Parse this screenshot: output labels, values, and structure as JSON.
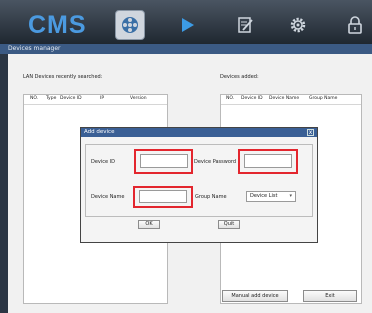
{
  "app": {
    "logo": "CMS"
  },
  "toolbar": {
    "items": [
      {
        "name": "video-reel-icon",
        "active": true
      },
      {
        "name": "play-icon",
        "active": false
      },
      {
        "name": "edit-icon",
        "active": false
      },
      {
        "name": "gear-icon",
        "active": false
      },
      {
        "name": "lock-icon",
        "active": false
      }
    ]
  },
  "window": {
    "title": "Devices manager"
  },
  "lan": {
    "label": "LAN Devices recently searched:",
    "columns": [
      "NO.",
      "Type",
      "Device ID",
      "IP",
      "Version"
    ]
  },
  "added": {
    "label": "Devices added:",
    "columns": [
      "NO.",
      "Device ID",
      "Device Name",
      "Group Name"
    ]
  },
  "dialog": {
    "title": "Add device",
    "close": "x",
    "device_id_label": "Device ID",
    "device_password_label": "Device Password",
    "device_name_label": "Device Name",
    "group_name_label": "Group Name",
    "group_selected": "Device List",
    "ok_label": "OK",
    "quit_label": "Quit"
  },
  "footer": {
    "manual_add_label": "Manual add device",
    "exit_label": "Exit"
  },
  "colors": {
    "highlight": "#e3262e",
    "logo": "#4b9ae0",
    "title_bar": "#3b5a84"
  }
}
